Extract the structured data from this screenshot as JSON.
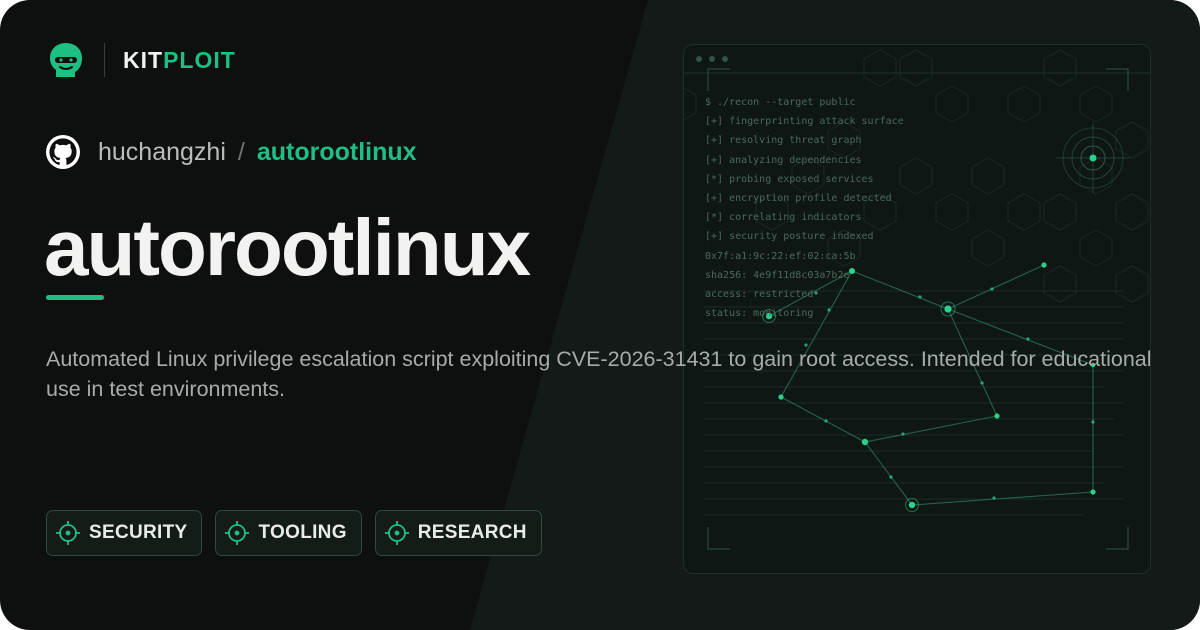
{
  "brand": {
    "name_part1": "KIT",
    "name_part2": "PLOIT",
    "logo_icon": "hacker-head-icon",
    "accent_color": "#1fbf83"
  },
  "repo": {
    "icon": "github-icon",
    "owner": "huchangzhi",
    "separator": "/",
    "name": "autorootlinux"
  },
  "title": "autorootlinux",
  "description": "Automated Linux privilege escalation script exploiting CVE-2026-31431 to gain root access. Intended for educational use in test environments.",
  "tags": [
    {
      "label": "SECURITY",
      "icon": "crosshair-icon"
    },
    {
      "label": "TOOLING",
      "icon": "crosshair-icon"
    },
    {
      "label": "RESEARCH",
      "icon": "crosshair-icon"
    }
  ],
  "terminal": {
    "lines": [
      "$ ./recon --target public",
      "[+] fingerprinting attack surface",
      "[+] resolving threat graph",
      "[+] analyzing dependencies",
      "[*] probing exposed services",
      "[+] encryption profile detected",
      "[*] correlating indicators",
      "[+] security posture indexed",
      "0x7f:a1:9c:22:ef:02:ca:5b",
      "sha256: 4e9f11d8c03a7b2e",
      "access: restricted",
      "status: monitoring"
    ]
  }
}
